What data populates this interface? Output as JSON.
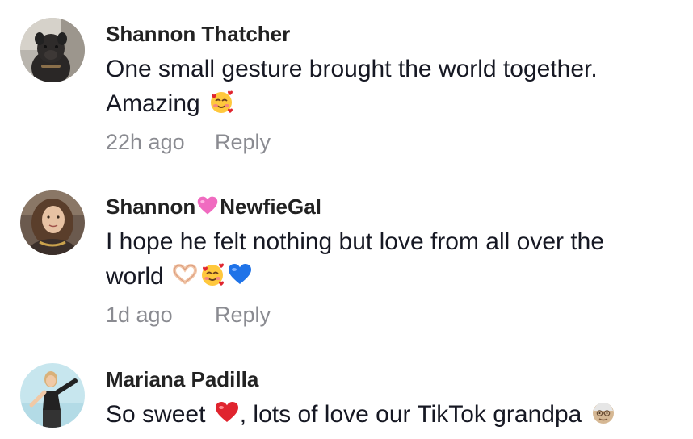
{
  "comments": [
    {
      "username": "Shannon Thatcher",
      "text_line1": "One small gesture brought the world together.",
      "text_line2": "Amazing",
      "emojis": [
        "smiling-face-with-hearts-icon"
      ],
      "time": "22h ago",
      "reply_label": "Reply"
    },
    {
      "username_part1": "Shannon",
      "username_part2": "NewfieGal",
      "username_emoji": "pink-heart-icon",
      "text_line1": "I hope he felt nothing but love from all over the",
      "text_line2": "world",
      "emojis": [
        "heart-hands-icon",
        "smiling-face-with-hearts-icon",
        "blue-heart-icon"
      ],
      "time": "1d ago",
      "reply_label": "Reply"
    },
    {
      "username": "Mariana Padilla",
      "text_part1": "So sweet",
      "text_part2": ", lots of love our TikTok grandpa",
      "emojis": [
        "red-heart-icon",
        "old-man-icon"
      ]
    }
  ],
  "colors": {
    "text": "#161823",
    "username": "#222222",
    "meta": "#8a8b91",
    "pink_heart": "#f06bc0",
    "blue_heart": "#1f73e8",
    "red_heart": "#e0242e"
  }
}
